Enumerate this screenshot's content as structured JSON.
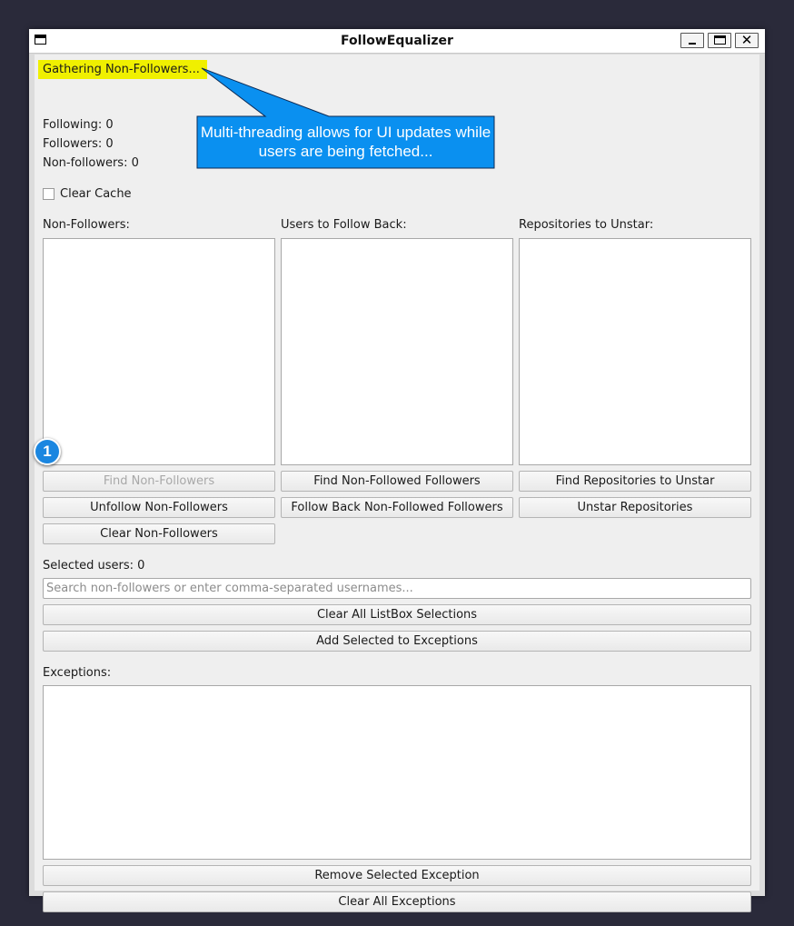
{
  "window": {
    "title": "FollowEqualizer",
    "close_glyph": "✕"
  },
  "status": {
    "message": "Gathering Non-Followers...",
    "highlight_color": "#f0f000"
  },
  "stats": {
    "following": "Following: 0",
    "followers": "Followers: 0",
    "non_followers": "Non-followers: 0"
  },
  "options": {
    "clear_cache_label": "Clear Cache",
    "clear_cache_checked": false
  },
  "columns": [
    {
      "label": "Non-Followers:",
      "buttons": [
        "Find Non-Followers",
        "Unfollow Non-Followers",
        "Clear Non-Followers"
      ],
      "disabled": [
        "Find Non-Followers"
      ]
    },
    {
      "label": "Users to Follow Back:",
      "buttons": [
        "Find Non-Followed Followers",
        "Follow Back Non-Followed Followers"
      ]
    },
    {
      "label": "Repositories to Unstar:",
      "buttons": [
        "Find Repositories to Unstar",
        "Unstar Repositories"
      ]
    }
  ],
  "selection": {
    "selected_users": "Selected users: 0",
    "search_placeholder": "Search non-followers or enter comma-separated usernames...",
    "search_value": "",
    "clear_selections_label": "Clear All ListBox Selections",
    "add_exceptions_label": "Add Selected to Exceptions"
  },
  "exceptions": {
    "label": "Exceptions:",
    "remove_label": "Remove Selected Exception",
    "clear_label": "Clear All Exceptions"
  },
  "annotation": {
    "callout_text": "Multi-threading allows for UI updates while users are being fetched...",
    "callout_color": "#0a90f0",
    "step_number": "1",
    "step_color": "#1a86e0"
  }
}
